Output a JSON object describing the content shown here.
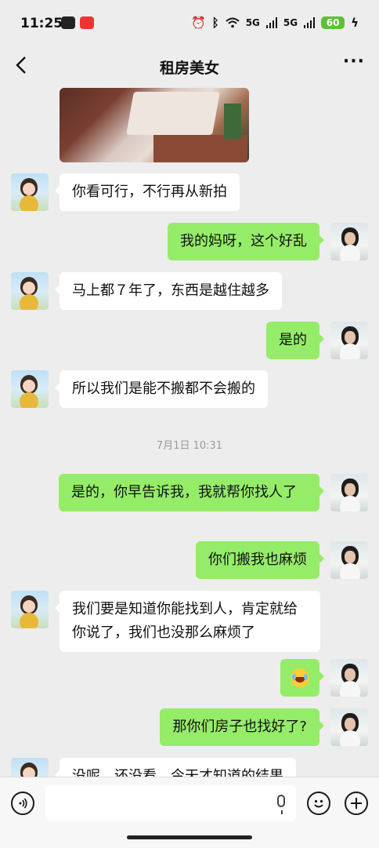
{
  "status": {
    "time": "11:25",
    "network_1": "5G",
    "network_2": "5G",
    "battery": "60"
  },
  "header": {
    "title": "租房美女"
  },
  "messages": [
    {
      "from": "her",
      "text": "你看可行，不行再从新拍"
    },
    {
      "from": "me",
      "text": "我的妈呀，这个好乱"
    },
    {
      "from": "her",
      "text": "马上都７年了，东西是越住越多"
    },
    {
      "from": "me",
      "text": "是的"
    },
    {
      "from": "her",
      "text": "所以我们是能不搬都不会搬的"
    },
    {
      "timestamp": "7月1日 10:31"
    },
    {
      "from": "me",
      "text": "是的，你早告诉我，我就帮你找人了"
    },
    {
      "from": "me",
      "text": "你们搬我也麻烦"
    },
    {
      "from": "her",
      "text": "我们要是知道你能找到人，肯定就给你说了，我们也没那么麻烦了"
    },
    {
      "from": "me",
      "emoji": "crying-laughing-emoji"
    },
    {
      "from": "me",
      "text": "那你们房子也找好了?"
    },
    {
      "from": "her",
      "text": "没呢，还没看，今天才知道的结果"
    }
  ],
  "icons": {
    "back": "chevron-left-icon",
    "more": "more-dots-icon",
    "voice": "voice-icon",
    "mic": "mic-icon",
    "emoji": "emoji-icon",
    "plus": "plus-icon"
  }
}
